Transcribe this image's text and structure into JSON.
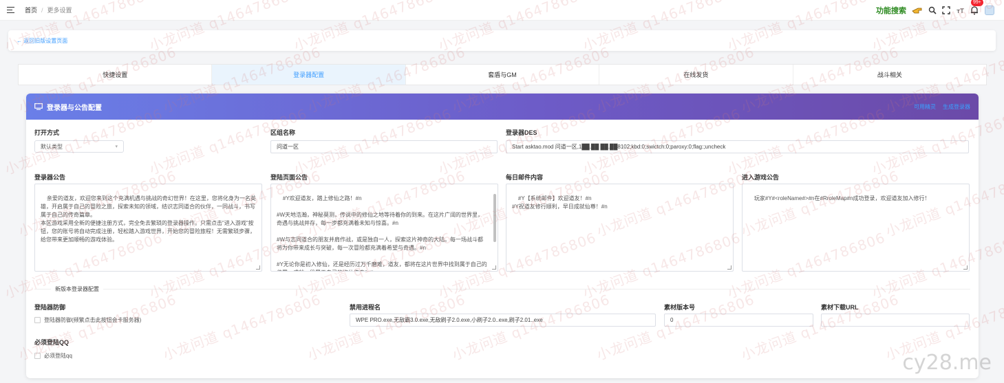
{
  "breadcrumb": {
    "home": "首页",
    "separator": "/",
    "current": "更多设置"
  },
  "topbar": {
    "feature_search": "功能搜索",
    "badge": "99+"
  },
  "back_link": "← 返回旧版设置页面",
  "tabs": [
    {
      "label": "快捷设置"
    },
    {
      "label": "登录器配置"
    },
    {
      "label": "套盾与GM"
    },
    {
      "label": "在线发货"
    },
    {
      "label": "战斗相关"
    }
  ],
  "panel": {
    "title": "登录器与公告配置",
    "actions": [
      "可用精灵",
      "生成登录器"
    ],
    "open_mode": {
      "label": "打开方式",
      "value": "默认类型"
    },
    "zone_name": {
      "label": "区组名称",
      "value": "问道一区"
    },
    "launcher_des": {
      "label": "登录器DES",
      "value": "Start asktao.mod 问道一区,1██.██ ██.██8102;kbd:0;swictch:0;paroxy:0;flag:;uncheck"
    },
    "launcher_notice": {
      "label": "登录器公告",
      "value": "亲爱的道友，欢迎您来到这个充满机遇与挑战的奇幻世界！在这里，您将化身为一名英雄，开启属于自己的冒险之旅，探索未知的领域，结识志同道合的伙伴，一同战斗，书写属于自己的传奇篇章。\n本区游戏采用全新的便捷注册方式，完全免去繁琐的登录器操作。只需点击\"进入游戏\"按钮，您的账号将自动完成注册，轻松踏入游戏世界，开始您的冒险旅程！无需繁琐步骤，给您带来更加顺畅的游戏体验。"
    },
    "login_page_notice": {
      "label": "登陆页面公告",
      "value": "#Y欢迎道友，踏上修仙之路！#n\n\n#W天地浩瀚，神秘莫测，传说中的修仙之地等待着你的到来。在这片广阔的世界里，奇遇与挑战并存，每一步都充满着未知与惊喜。#n\n\n#W与志同道合的朋友并肩作战，或是独自一人，探索这片神奇的大陆。每一场战斗都将为你带来成长与突破，每一次冒险都充满着希望与奇遇。#n\n\n#Y无论你是初入修仙，还是经历过万千磨难，道友，都将在这片世界中找到属于自己的位置，成就一段属于自己的修仙传奇！#n"
    },
    "daily_mail": {
      "label": "每日邮件内容",
      "value": "#Y【系统邮件】欢迎道友！#n\n#Y祝道友修行顺利，早日成就仙尊！#n"
    },
    "enter_notice": {
      "label": "进入游戏公告",
      "value": "玩家#Y#<roleName#>#n在#RroleMap#n成功登录，欢迎道友加入修行！"
    },
    "new_section_title": "新版本登录器配置",
    "anti_defense": {
      "label": "登陆器防御",
      "checkbox": "登陆器防御(频繁点击此按钮会卡服务器)"
    },
    "banned_process": {
      "label": "禁用进程名",
      "value": "WPE PRO.exe,无敌霸3.0.exe,无敌刷子2.0.exe,小刷子2.0..exe,刷子2.01..exe"
    },
    "asset_version": {
      "label": "素材版本号",
      "value": "0"
    },
    "asset_url": {
      "label": "素材下载URL",
      "value": ""
    },
    "must_login_qq": {
      "label": "必须登陆QQ",
      "checkbox": "必须登陆qq"
    }
  },
  "watermark": "小龙问道 q1464786806",
  "site_mark": "cy28.me",
  "colors": {
    "accent": "#409eff",
    "header_start": "#6a7fe8",
    "header_end": "#6b4aa8",
    "feature_search": "#2e8b22",
    "badge": "#f5222d"
  }
}
